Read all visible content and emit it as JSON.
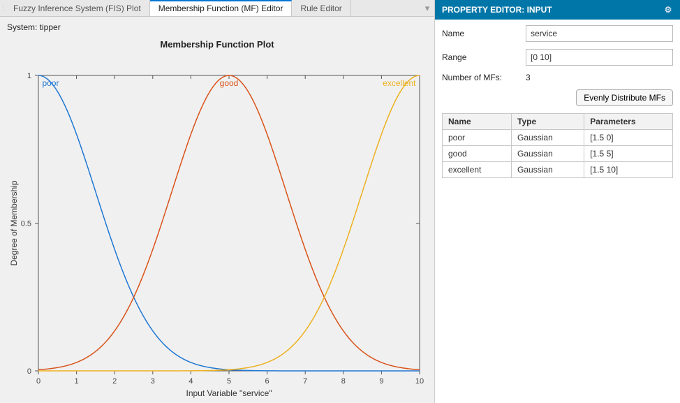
{
  "tabs": {
    "fis": "Fuzzy Inference System (FIS) Plot",
    "mf": "Membership Function (MF) Editor",
    "rule": "Rule Editor"
  },
  "system_label": "System: tipper",
  "plot_title": "Membership Function Plot",
  "xaxis_label": "Input Variable \"service\"",
  "yaxis_label": "Degree of Membership",
  "property_editor": {
    "title": "PROPERTY EDITOR: INPUT",
    "name_label": "Name",
    "name_value": "service",
    "range_label": "Range",
    "range_value": "[0 10]",
    "nmfs_label": "Number of MFs:",
    "nmfs_value": "3",
    "distribute_btn": "Evenly Distribute MFs",
    "table_headers": {
      "name": "Name",
      "type": "Type",
      "params": "Parameters"
    },
    "rows": [
      {
        "name": "poor",
        "type": "Gaussian",
        "params": "[1.5 0]"
      },
      {
        "name": "good",
        "type": "Gaussian",
        "params": "[1.5 5]"
      },
      {
        "name": "excellent",
        "type": "Gaussian",
        "params": "[1.5 10]"
      }
    ]
  },
  "chart_data": {
    "type": "line",
    "title": "Membership Function Plot",
    "xlabel": "Input Variable \"service\"",
    "ylabel": "Degree of Membership",
    "xlim": [
      0,
      10
    ],
    "ylim": [
      0,
      1
    ],
    "xticks": [
      0,
      1,
      2,
      3,
      4,
      5,
      6,
      7,
      8,
      9,
      10
    ],
    "yticks": [
      0,
      0.5,
      1
    ],
    "series": [
      {
        "name": "poor",
        "color": "#1f77d4",
        "sigma": 1.5,
        "mean": 0
      },
      {
        "name": "good",
        "color": "#d95319",
        "sigma": 1.5,
        "mean": 5
      },
      {
        "name": "excellent",
        "color": "#edb120",
        "sigma": 1.5,
        "mean": 10
      }
    ],
    "mf_labels": [
      {
        "name": "poor",
        "color": "#1f77d4",
        "x": 0.1,
        "anchor": "start"
      },
      {
        "name": "good",
        "color": "#d95319",
        "x": 5,
        "anchor": "middle"
      },
      {
        "name": "excellent",
        "color": "#edb120",
        "x": 9.9,
        "anchor": "end"
      }
    ]
  }
}
